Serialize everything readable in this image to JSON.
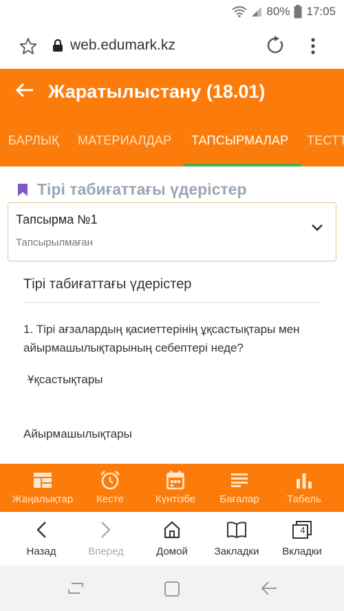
{
  "status_bar": {
    "battery": "80%",
    "time": "17:05"
  },
  "browser": {
    "url": "web.edumark.kz"
  },
  "header": {
    "title": "Жаратылыстану (18.01)",
    "tabs": [
      "БАРЛЫҚ",
      "МАТЕРИАЛДАР",
      "ТАПСЫРМАЛАР",
      "ТЕСТТ"
    ],
    "active_tab": "ТАПСЫРМАЛАР"
  },
  "section": {
    "title": "Тірі табиғаттағы үдерістер"
  },
  "task": {
    "title": "Тапсырма №1",
    "status": "Тапсырылмаған"
  },
  "content": {
    "title": "Тірі табиғаттағы үдерістер",
    "question": "1. Тірі ағзалардың қасиеттерінің ұқсастықтары мен айырмашылықтарының себептері неде?",
    "answer1": "Ұқсастықтары",
    "answer2": "Айырмашылықтары"
  },
  "app_nav": {
    "items": [
      {
        "label": "Жаңалықтар",
        "icon": "news-icon"
      },
      {
        "label": "Кесте",
        "icon": "clock-icon"
      },
      {
        "label": "Күнтізбе",
        "icon": "calendar-icon"
      },
      {
        "label": "Бағалар",
        "icon": "grades-icon"
      },
      {
        "label": "Табель",
        "icon": "bar-chart-icon"
      }
    ]
  },
  "browser_nav": {
    "items": [
      {
        "label": "Назад",
        "icon": "back-icon"
      },
      {
        "label": "Вперед",
        "icon": "forward-icon"
      },
      {
        "label": "Домой",
        "icon": "home-icon"
      },
      {
        "label": "Закладки",
        "icon": "bookmarks-icon"
      },
      {
        "label": "Вкладки",
        "icon": "tabs-icon",
        "count": "4"
      }
    ]
  },
  "colors": {
    "brand": "#fb7c0b",
    "tab_indicator": "#4caf50",
    "section_title": "#9aa6b2",
    "bookmark": "#7e57c2"
  }
}
